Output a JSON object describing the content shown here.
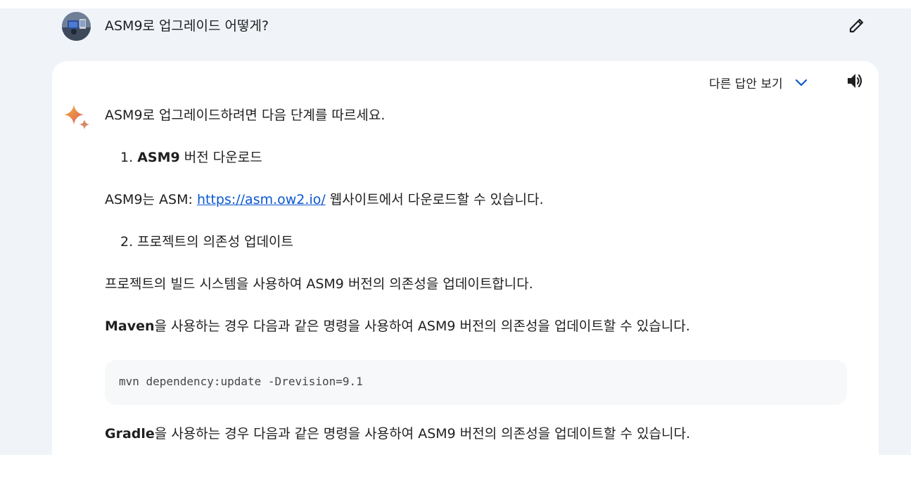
{
  "prompt": {
    "text": "ASM9로 업그레이드 어떻게?",
    "avatar_icon": "user-avatar",
    "edit_icon": "pencil-icon"
  },
  "response": {
    "drafts_label": "다른 답안 보기",
    "drafts_icon": "chevron-down-icon",
    "speaker_icon": "speaker-icon",
    "sparkle_icon": "sparkle-icon",
    "intro": "ASM9로 업그레이드하려면 다음 단계를 따르세요.",
    "step1_number": "1.",
    "step1_bold": "ASM9",
    "step1_rest": " 버전 다운로드",
    "p1_before": "ASM9는 ASM: ",
    "p1_link": "https://asm.ow2.io/",
    "p1_after": " 웹사이트에서 다운로드할 수 있습니다.",
    "step2": "2. 프로젝트의 의존성 업데이트",
    "p2": "프로젝트의 빌드 시스템을 사용하여 ASM9 버전의 의존성을 업데이트합니다.",
    "p3_bold": "Maven",
    "p3_rest": "을 사용하는 경우 다음과 같은 명령을 사용하여 ASM9 버전의 의존성을 업데이트할 수 있습니다.",
    "code": "mvn dependency:update -Drevision=9.1",
    "p4_bold": "Gradle",
    "p4_rest": "을 사용하는 경우 다음과 같은 명령을 사용하여 ASM9 버전의 의존성을 업데이트할 수 있습니다."
  },
  "colors": {
    "page_background": "#f0f4f9",
    "card_background": "#ffffff",
    "link": "#0b57d0",
    "chevron": "#0b57d0",
    "code_background": "#f7f8fa"
  }
}
